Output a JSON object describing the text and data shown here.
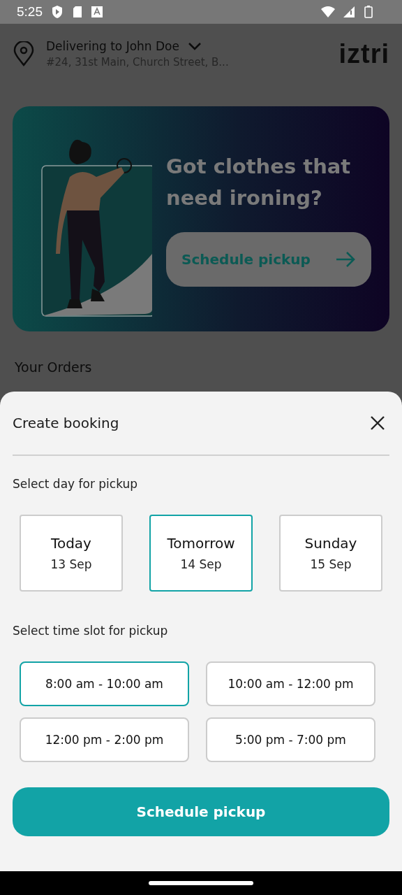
{
  "status_bar": {
    "time": "5:25"
  },
  "header": {
    "title": "Delivering to John Doe",
    "address": "#24, 31st Main, Church Street, B...",
    "logo": "iztri"
  },
  "banner": {
    "headline": "Got clothes that need ironing?",
    "button": "Schedule pickup"
  },
  "orders_heading": "Your Orders",
  "sheet": {
    "title": "Create booking",
    "day_label": "Select day for pickup",
    "days": [
      {
        "name": "Today",
        "date": "13 Sep",
        "selected": false
      },
      {
        "name": "Tomorrow",
        "date": "14 Sep",
        "selected": true
      },
      {
        "name": "Sunday",
        "date": "15 Sep",
        "selected": false
      }
    ],
    "slot_label": "Select time slot for pickup",
    "slots": [
      {
        "label": "8:00 am - 10:00 am",
        "selected": true
      },
      {
        "label": "10:00 am - 12:00 pm",
        "selected": false
      },
      {
        "label": "12:00 pm - 2:00 pm",
        "selected": false
      },
      {
        "label": "5:00 pm - 7:00 pm",
        "selected": false
      }
    ],
    "button": "Schedule pickup"
  }
}
